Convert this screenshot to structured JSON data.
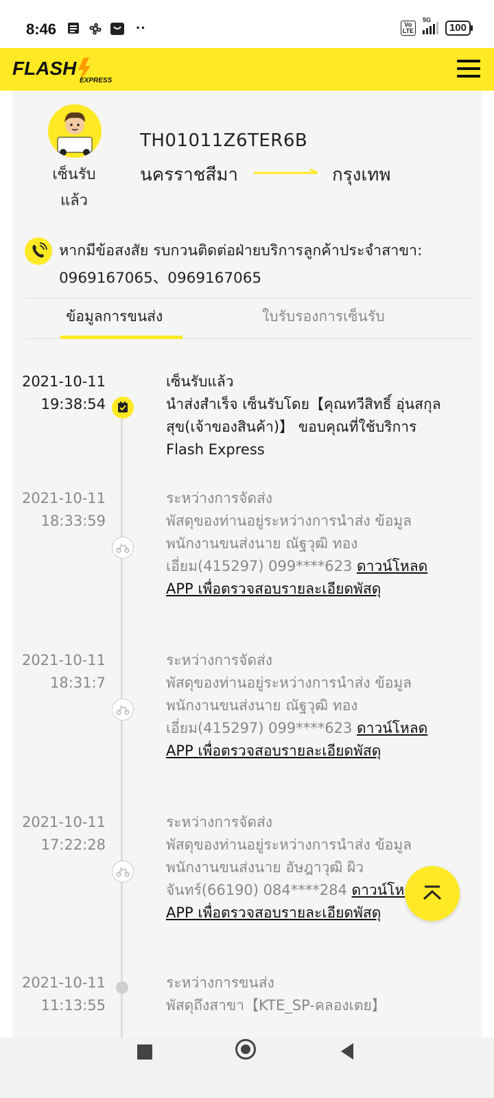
{
  "status_bar": {
    "time": "8:46",
    "volte": "Vo\nLTE",
    "network": "5G",
    "battery": "100"
  },
  "header": {
    "logo_text": "FLASH",
    "logo_sub": "EXPRESS"
  },
  "parcel": {
    "status": "เซ็นรับแล้ว",
    "tracking_no": "TH01011Z6TER6B",
    "from": "นครราชสีมา",
    "to": "กรุงเทพ"
  },
  "contact": {
    "text": "หากมีข้อสงสัย รบกวนติดต่อฝ่ายบริการลูกค้าประจำสาขา: 0969167065、0969167065"
  },
  "tabs": [
    {
      "label": "ข้อมูลการขนส่ง",
      "active": true
    },
    {
      "label": "ใบรับรองการเซ็นรับ",
      "active": false
    }
  ],
  "events": [
    {
      "date": "2021-10-11",
      "time": "19:38:54",
      "title": "เซ็นรับแล้ว",
      "text": "นำส่งสำเร็จ เซ็นรับโดย【คุณทวีสิทธิ์ อุ่นสกุลสุข(เจ้าของสินค้า)】 ขอบคุณที่ใช้บริการ Flash Express",
      "link": ""
    },
    {
      "date": "2021-10-11",
      "time": "18:33:59",
      "title": "ระหว่างการจัดส่ง",
      "text": "พัสดุของท่านอยู่ระหว่างการนำส่ง ข้อมูลพนักงานขนส่งนาย ณัฐวุฒิ ทองเอี่ยม(415297) 099****623 ",
      "link": "ดาวน์โหลด APP เพื่อตรวจสอบรายละเอียดพัสดุ"
    },
    {
      "date": "2021-10-11",
      "time": "18:31:7",
      "title": "ระหว่างการจัดส่ง",
      "text": "พัสดุของท่านอยู่ระหว่างการนำส่ง ข้อมูลพนักงานขนส่งนาย ณัฐวุฒิ ทองเอี่ยม(415297) 099****623 ",
      "link": "ดาวน์โหลด APP เพื่อตรวจสอบรายละเอียดพัสดุ"
    },
    {
      "date": "2021-10-11",
      "time": "17:22:28",
      "title": "ระหว่างการจัดส่ง",
      "text": "พัสดุของท่านอยู่ระหว่างการนำส่ง ข้อมูลพนักงานขนส่งนาย อัษฎาวุฒิ ผิวจันทร์(66190) 084****284 ",
      "link": "ดาวน์โหลด APP เพื่อตรวจสอบรายละเอียดพัสดุ"
    },
    {
      "date": "2021-10-11",
      "time": "11:13:55",
      "title": "ระหว่างการขนส่ง",
      "text": "พัสดุถึงสาขา【KTE_SP-คลองเตย】",
      "link": ""
    }
  ],
  "colors": {
    "brand_yellow": "#ffe924",
    "text_dark": "#2a2a2a",
    "text_grey": "#888888"
  }
}
